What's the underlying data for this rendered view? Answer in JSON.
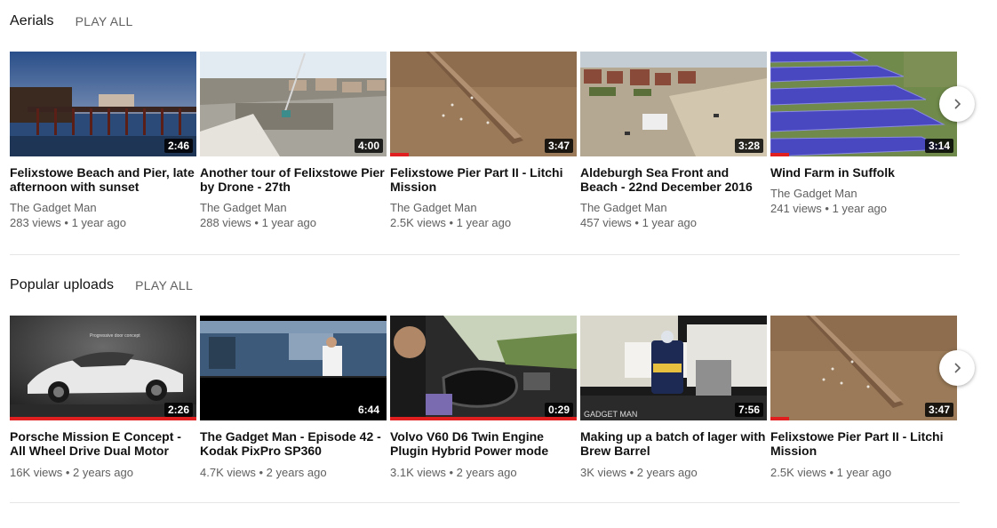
{
  "shelves": [
    {
      "title": "Aerials",
      "play_all": "PLAY ALL",
      "videos": [
        {
          "title": "Felixstowe Beach and Pier, late afternoon with sunset",
          "channel": "The Gadget Man",
          "meta": "283 views • 1 year ago",
          "duration": "2:46",
          "progress": 0
        },
        {
          "title": "Another tour of Felixstowe Pier by Drone - 27th",
          "channel": "The Gadget Man",
          "meta": "288 views • 1 year ago",
          "duration": "4:00",
          "progress": 0
        },
        {
          "title": "Felixstowe Pier Part II - Litchi Mission",
          "channel": "The Gadget Man",
          "meta": "2.5K views • 1 year ago",
          "duration": "3:47",
          "progress": 0.1
        },
        {
          "title": "Aldeburgh Sea Front and Beach - 22nd December 2016",
          "channel": "The Gadget Man",
          "meta": "457 views • 1 year ago",
          "duration": "3:28",
          "progress": 0
        },
        {
          "title": "Wind Farm in Suffolk",
          "channel": "The Gadget Man",
          "meta": "241 views • 1 year ago",
          "duration": "3:14",
          "progress": 0.1
        }
      ]
    },
    {
      "title": "Popular uploads",
      "play_all": "PLAY ALL",
      "videos": [
        {
          "title": "Porsche Mission E Concept - All Wheel Drive Dual Motor",
          "channel": "",
          "meta": "16K views • 2 years ago",
          "duration": "2:26",
          "progress": 1.0,
          "thumb_text": "Progressive door concept"
        },
        {
          "title": "The Gadget Man - Episode 42 - Kodak PixPro SP360",
          "channel": "",
          "meta": "4.7K views • 2 years ago",
          "duration": "6:44",
          "progress": 0
        },
        {
          "title": "Volvo V60 D6 Twin Engine Plugin Hybrid Power mode",
          "channel": "",
          "meta": "3.1K views • 2 years ago",
          "duration": "0:29",
          "progress": 1.0
        },
        {
          "title": "Making up a batch of lager with Brew Barrel",
          "channel": "",
          "meta": "3K views • 2 years ago",
          "duration": "7:56",
          "progress": 0,
          "thumb_text": "GADGET MAN"
        },
        {
          "title": "Felixstowe Pier Part II - Litchi Mission",
          "channel": "",
          "meta": "2.5K views • 1 year ago",
          "duration": "3:47",
          "progress": 0.1
        }
      ]
    }
  ],
  "next_icon": "chevron-right-icon",
  "accent_color": "#e02020"
}
